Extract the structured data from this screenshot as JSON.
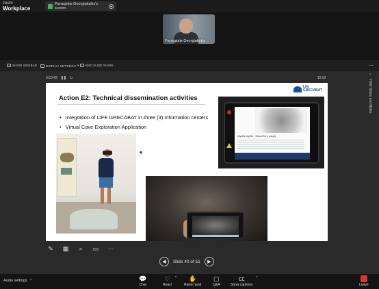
{
  "app": {
    "brand_small": "zoom",
    "brand_big": "Workplace"
  },
  "share_tab": {
    "label": "Panagiotis Georgiakakis's screen"
  },
  "participant": {
    "name": "Panagiotis Georgiakakis"
  },
  "share_toolbar": {
    "items": [
      "SHOW SIDEBAR",
      "DISPLAY SETTINGS",
      "END SLIDE SHOW"
    ],
    "display_caret": "▾"
  },
  "presenter": {
    "timer": "0:50:43",
    "clock": "10:52",
    "side_label": "Hide Slides and Notes"
  },
  "slide": {
    "title": "Action E2: Technical dissemination activities",
    "bullets": [
      "Integration of LIFE GRECABAT in three (3) information centers",
      "Virtual Cave Exploration Application"
    ],
    "logo_text_1": "Life",
    "logo_text_2": "GRECABAT",
    "tablet_caption": "Myotis blythii · Μυωτίδα η μικρή"
  },
  "navigation": {
    "counter": "Slide 40 of 51"
  },
  "bottom_bar": {
    "audio_label": "Audio settings",
    "controls": [
      "Chat",
      "React",
      "Raise hand",
      "Q&A",
      "Show captions"
    ],
    "leave": "Leave"
  },
  "colors": {
    "leave_red": "#d53a2f",
    "share_green": "#3cb371",
    "grecabat_blue": "#1d4f91"
  }
}
